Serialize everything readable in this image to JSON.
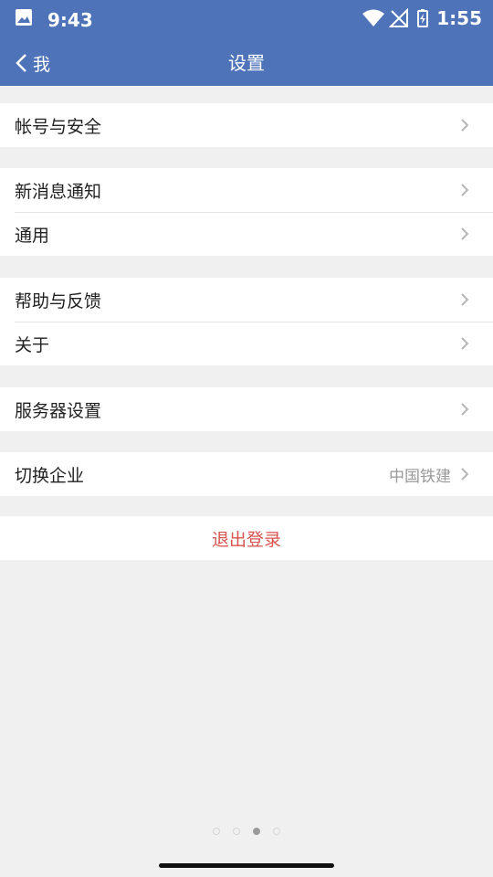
{
  "status_bar": {
    "time": "9:43",
    "battery_time": "1:55",
    "icons": [
      "photo-icon",
      "wifi-icon",
      "no-signal-icon",
      "battery-charging-icon"
    ]
  },
  "nav": {
    "back_label": "我",
    "title": "设置"
  },
  "groups": [
    {
      "items": [
        {
          "label": "帐号与安全"
        }
      ]
    },
    {
      "items": [
        {
          "label": "新消息通知"
        },
        {
          "label": "通用"
        }
      ]
    },
    {
      "items": [
        {
          "label": "帮助与反馈"
        },
        {
          "label": "关于"
        }
      ]
    },
    {
      "items": [
        {
          "label": "服务器设置"
        }
      ]
    },
    {
      "items": [
        {
          "label": "切换企业",
          "value": "中国铁建"
        }
      ]
    }
  ],
  "logout": {
    "label": "退出登录",
    "color": "#d9534f"
  },
  "page_indicator": {
    "count": 4,
    "active_index": 2
  },
  "colors": {
    "header": "#4f73b9",
    "background": "#f0f0f0"
  }
}
